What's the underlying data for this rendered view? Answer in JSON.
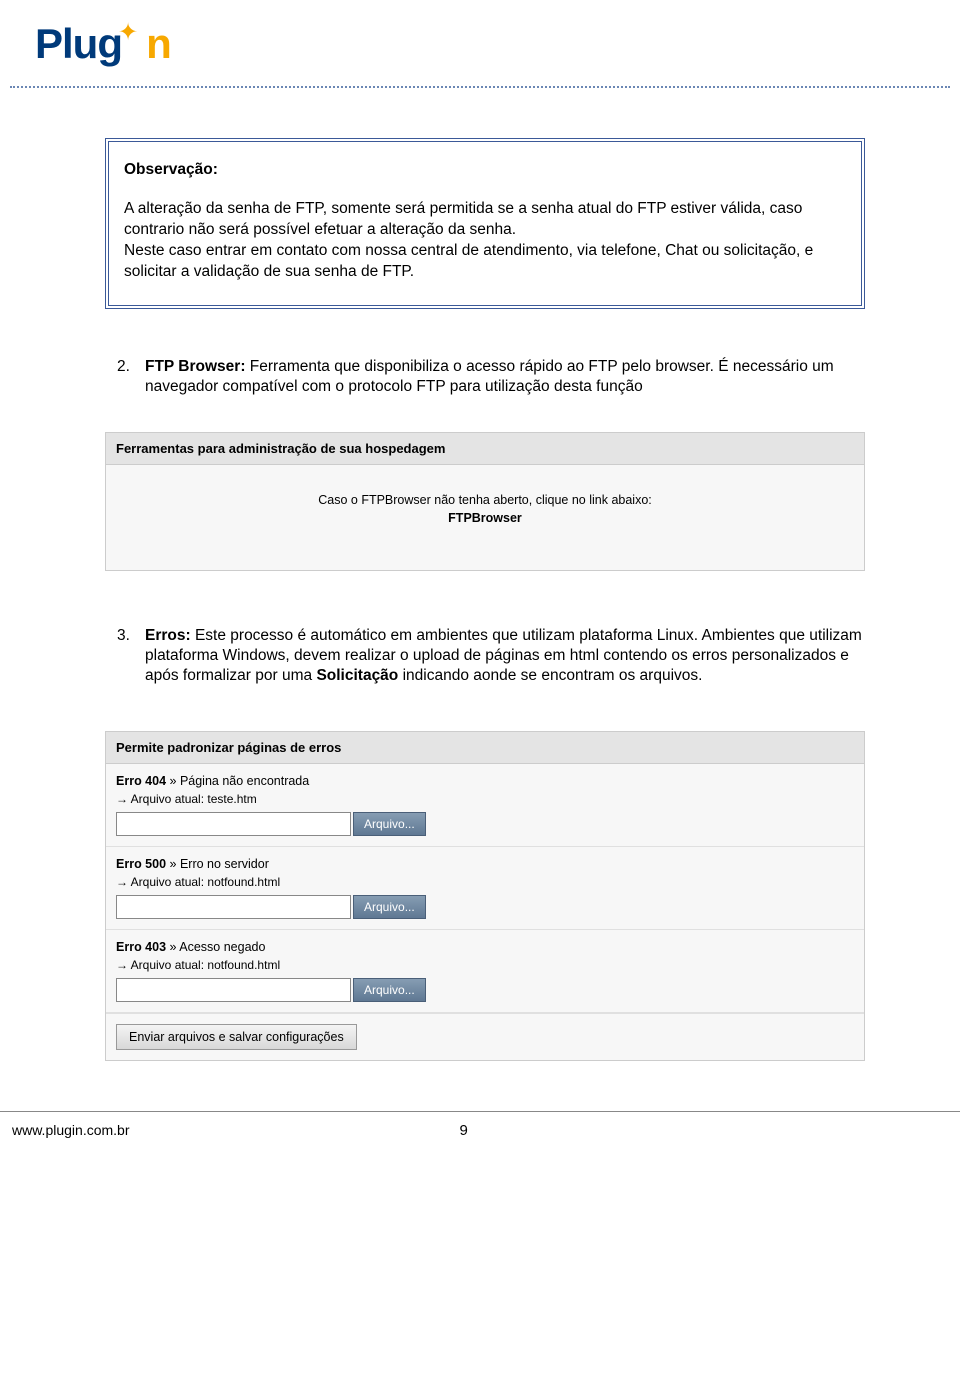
{
  "logo": {
    "pre": "Plug",
    "post": "n"
  },
  "observation": {
    "heading": "Observação:",
    "para1": "A alteração da senha de FTP, somente será permitida se a senha atual do FTP estiver válida, caso contrario não será possível efetuar a alteração da senha.",
    "para2": "Neste caso entrar em contato com nossa central de atendimento, via telefone, Chat ou solicitação, e solicitar a validação de sua senha de FTP."
  },
  "item2": {
    "num": "2.",
    "label": "FTP Browser:",
    "text": " Ferramenta que disponibiliza o acesso rápido ao FTP pelo browser. É necessário um navegador compatível com o protocolo FTP para utilização desta função"
  },
  "ftp_widget": {
    "title": "Ferramentas para administração de sua hospedagem",
    "instr": "Caso o FTPBrowser não tenha aberto, clique no link abaixo:",
    "link": "FTPBrowser"
  },
  "item3": {
    "num": "3.",
    "label": "Erros:",
    "text1": " Este processo é automático em ambientes que utilizam plataforma Linux. Ambientes que utilizam plataforma Windows, devem realizar o upload de páginas em html contendo os erros personalizados e após formalizar por uma ",
    "bold2": "Solicitação",
    "text2": " indicando aonde se encontram os arquivos."
  },
  "err_widget": {
    "title": "Permite padronizar páginas de erros",
    "rows": [
      {
        "code": "Erro 404",
        "sep": " » ",
        "desc": "Página não encontrada",
        "file_prefix": "→ Arquivo atual: ",
        "file": "teste.htm",
        "btn": "Arquivo..."
      },
      {
        "code": "Erro 500",
        "sep": " » ",
        "desc": "Erro no servidor",
        "file_prefix": "→ Arquivo atual: ",
        "file": "notfound.html",
        "btn": "Arquivo..."
      },
      {
        "code": "Erro 403",
        "sep": " » ",
        "desc": "Acesso negado",
        "file_prefix": "→ Arquivo atual: ",
        "file": "notfound.html",
        "btn": "Arquivo..."
      }
    ],
    "submit": "Enviar arquivos e salvar configurações"
  },
  "footer": {
    "url": "www.plugin.com.br",
    "page": "9"
  }
}
